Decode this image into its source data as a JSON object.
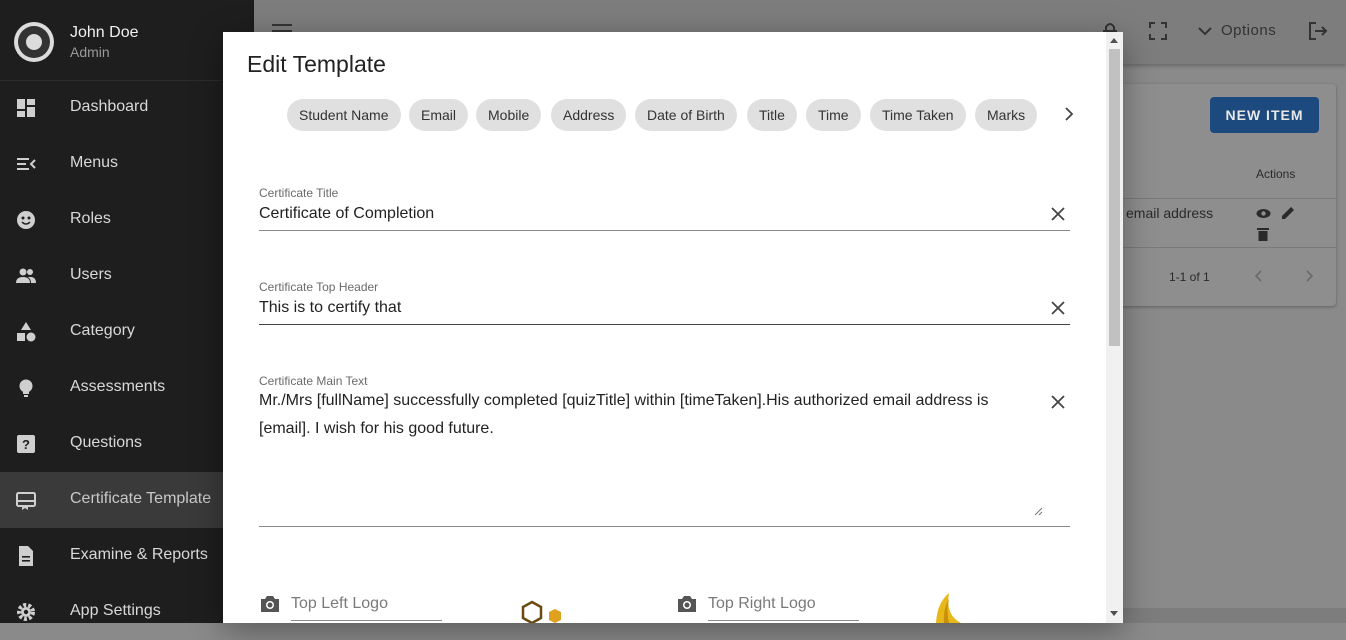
{
  "user": {
    "name": "John Doe",
    "role": "Admin"
  },
  "sidebar": {
    "items": [
      {
        "label": "Dashboard",
        "icon": "dashboard-icon"
      },
      {
        "label": "Menus",
        "icon": "menu-open-icon"
      },
      {
        "label": "Roles",
        "icon": "face-icon"
      },
      {
        "label": "Users",
        "icon": "people-icon"
      },
      {
        "label": "Category",
        "icon": "category-shapes-icon"
      },
      {
        "label": "Assessments",
        "icon": "lightbulb-icon"
      },
      {
        "label": "Questions",
        "icon": "help-box-icon"
      },
      {
        "label": "Certificate Template",
        "icon": "card-membership-icon",
        "active": true
      },
      {
        "label": "Examine & Reports",
        "icon": "description-icon"
      },
      {
        "label": "App Settings",
        "icon": "settings-icon"
      }
    ]
  },
  "topbar": {
    "options_label": "Options"
  },
  "background": {
    "new_item_label": "NEW ITEM",
    "actions_header": "Actions",
    "row_text": "email address",
    "pagination": "1-1 of 1"
  },
  "modal": {
    "title": "Edit Template",
    "chips": [
      "Student Name",
      "Email",
      "Mobile",
      "Address",
      "Date of Birth",
      "Title",
      "Time",
      "Time Taken",
      "Marks"
    ],
    "fields": {
      "certificate_title": {
        "label": "Certificate Title",
        "value": "Certificate of Completion"
      },
      "top_header": {
        "label": "Certificate Top Header",
        "value": "This is to certify that"
      },
      "main_text": {
        "label": "Certificate Main Text",
        "value": "Mr./Mrs [fullName] successfully completed [quizTitle] within [timeTaken].His authorized email address is [email]. I wish for his good future."
      }
    },
    "uploads": {
      "top_left": {
        "label": "Top Left Logo"
      },
      "top_right": {
        "label": "Top Right Logo"
      }
    }
  },
  "colors": {
    "primary": "#1c4a7e",
    "sidebar_bg": "#1e1e1e",
    "chip_bg": "#e0e0e0",
    "overlay": "#8a8a8a"
  }
}
